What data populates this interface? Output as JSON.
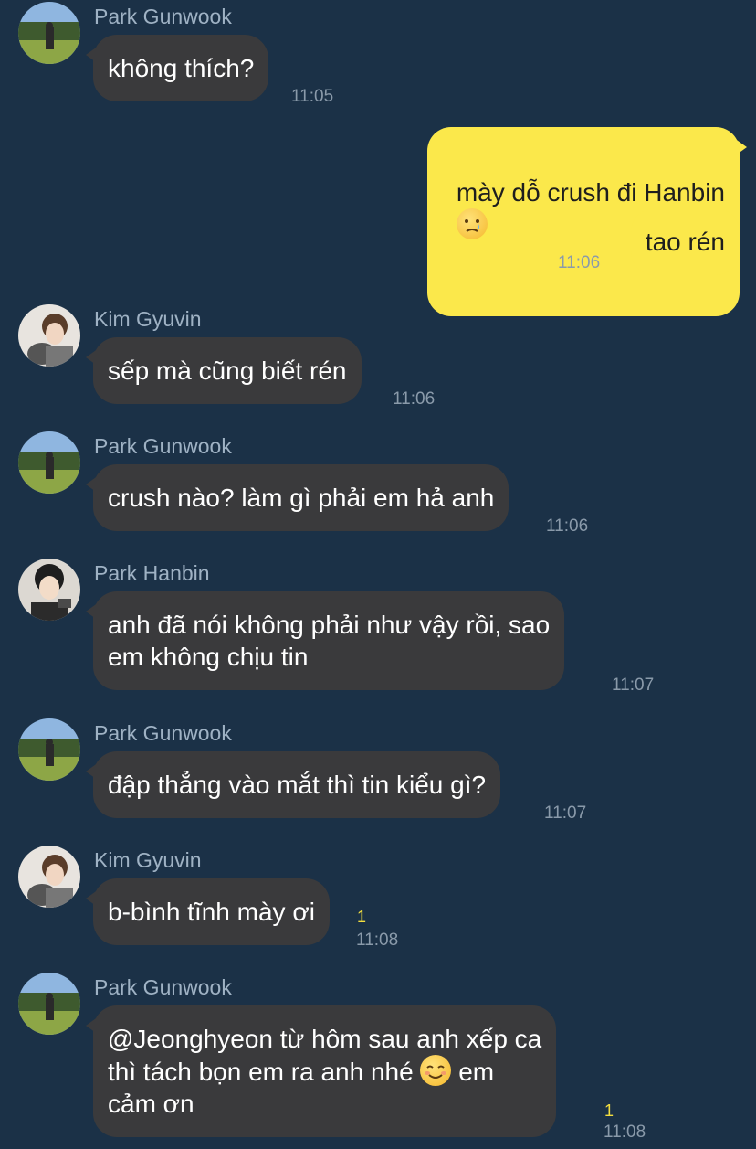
{
  "messages": [
    {
      "sender": "Park Gunwook",
      "text": "không thích?",
      "time": "11:05"
    },
    {
      "text": "mày dỗ crush đi Hanbin",
      "emoji": "crying-face"
    },
    {
      "text": "tao rén",
      "time": "11:06"
    },
    {
      "sender": "Kim Gyuvin",
      "text": "sếp mà cũng biết rén",
      "time": "11:06"
    },
    {
      "sender": "Park Gunwook",
      "text": "crush nào? làm gì phải em hả anh",
      "time": "11:06"
    },
    {
      "sender": "Park Hanbin",
      "text": "anh đã nói không phải như vậy rồi, sao\nem không chịu tin",
      "time": "11:07"
    },
    {
      "sender": "Park Gunwook",
      "text": "đập thẳng vào mắt thì tin kiểu gì?",
      "time": "11:07"
    },
    {
      "sender": "Kim Gyuvin",
      "text": "b-bình tĩnh mày ơi",
      "time": "11:08",
      "unread": "1"
    },
    {
      "sender": "Park Gunwook",
      "text_a": "@Jeonghyeon từ hôm sau anh xếp ca\nthì tách bọn em ra anh nhé ",
      "text_b": " em\ncảm ơn",
      "emoji": "smiling-face",
      "time": "11:08",
      "unread": "1"
    }
  ],
  "colors": {
    "background": "#1b3147",
    "incoming_bubble": "#3a3a3c",
    "outgoing_bubble": "#fbe84b",
    "unread": "#f3de3f"
  }
}
